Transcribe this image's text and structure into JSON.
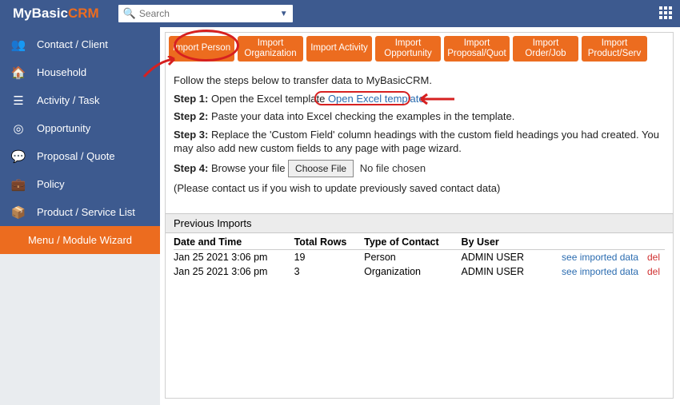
{
  "header": {
    "logo_a": "MyBasic",
    "logo_b": "CRM",
    "search_placeholder": "Search"
  },
  "sidebar": {
    "items": [
      {
        "icon": "👥",
        "label": "Contact / Client",
        "name": "sidebar-item-contact"
      },
      {
        "icon": "🏠",
        "label": "Household",
        "name": "sidebar-item-household"
      },
      {
        "icon": "☰",
        "label": "Activity / Task",
        "name": "sidebar-item-activity"
      },
      {
        "icon": "◎",
        "label": "Opportunity",
        "name": "sidebar-item-opportunity"
      },
      {
        "icon": "💬",
        "label": "Proposal / Quote",
        "name": "sidebar-item-proposal"
      },
      {
        "icon": "💼",
        "label": "Policy",
        "name": "sidebar-item-policy"
      },
      {
        "icon": "📦",
        "label": "Product / Service List",
        "name": "sidebar-item-product"
      }
    ],
    "wizard_label": "Menu / Module Wizard"
  },
  "tabs": [
    {
      "label": "Import Person",
      "name": "tab-import-person"
    },
    {
      "label": "Import Organization",
      "name": "tab-import-org"
    },
    {
      "label": "Import Activity",
      "name": "tab-import-activity"
    },
    {
      "label": "Import Opportunity",
      "name": "tab-import-opportunity"
    },
    {
      "label": "Import Proposal/Quot",
      "name": "tab-import-proposal"
    },
    {
      "label": "Import Order/Job",
      "name": "tab-import-order"
    },
    {
      "label": "Import Product/Serv",
      "name": "tab-import-product"
    }
  ],
  "content": {
    "intro": "Follow the steps below to transfer data to MyBasicCRM.",
    "step1_label": "Step 1:",
    "step1_text": " Open the Excel template ",
    "step1_link": "Open Excel template",
    "step2_label": "Step 2:",
    "step2_text": " Paste your data into Excel checking the examples in the template.",
    "step3_label": "Step 3:",
    "step3_text": " Replace the 'Custom Field' column headings with the custom field headings you had created. You may also add new custom fields to any page with page wizard.",
    "step4_label": "Step 4:",
    "step4_text": " Browse your file ",
    "choose_file": "Choose File",
    "no_file": "No file chosen",
    "note": "(Please contact us if you wish to update previously saved contact data)",
    "prev_header": "Previous Imports",
    "th_date": "Date and Time",
    "th_rows": "Total Rows",
    "th_type": "Type of Contact",
    "th_user": "By User",
    "rows": [
      {
        "date": "Jan 25 2021 3:06 pm",
        "rows": "19",
        "type": "Person",
        "user": "ADMIN USER",
        "link": "see imported data",
        "del": "del"
      },
      {
        "date": "Jan 25 2021 3:06 pm",
        "rows": "3",
        "type": "Organization",
        "user": "ADMIN USER",
        "link": "see imported data",
        "del": "del"
      }
    ]
  }
}
